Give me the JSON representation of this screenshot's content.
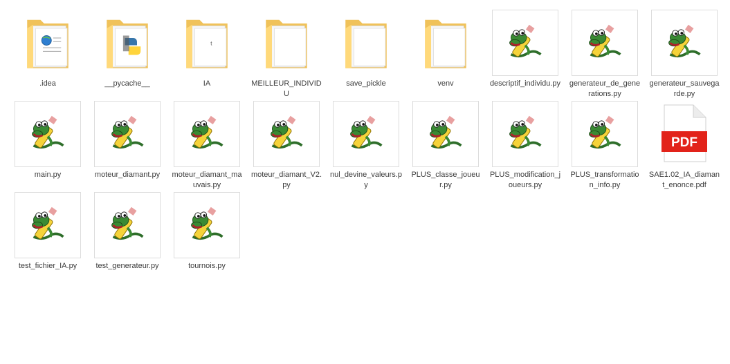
{
  "items": [
    {
      "name": ".idea",
      "kind": "folder",
      "preview": "web-doc"
    },
    {
      "name": "__pycache__",
      "kind": "folder",
      "preview": "python-doc"
    },
    {
      "name": "IA",
      "kind": "folder",
      "preview": "text-doc"
    },
    {
      "name": "MEILLEUR_INDIVIDU",
      "kind": "folder",
      "preview": "blank-doc"
    },
    {
      "name": "save_pickle",
      "kind": "folder",
      "preview": "blank-doc"
    },
    {
      "name": "venv",
      "kind": "folder",
      "preview": "blank-doc"
    },
    {
      "name": "descriptif_individu.py",
      "kind": "python"
    },
    {
      "name": "generateur_de_generations.py",
      "kind": "python"
    },
    {
      "name": "generateur_sauvegarde.py",
      "kind": "python"
    },
    {
      "name": "main.py",
      "kind": "python"
    },
    {
      "name": "moteur_diamant.py",
      "kind": "python"
    },
    {
      "name": "moteur_diamant_mauvais.py",
      "kind": "python"
    },
    {
      "name": "moteur_diamant_V2.py",
      "kind": "python"
    },
    {
      "name": "nul_devine_valeurs.py",
      "kind": "python"
    },
    {
      "name": "PLUS_classe_joueur.py",
      "kind": "python"
    },
    {
      "name": "PLUS_modification_joueurs.py",
      "kind": "python"
    },
    {
      "name": "PLUS_transformation_info.py",
      "kind": "python"
    },
    {
      "name": "SAE1.02_IA_diamant_enonce.pdf",
      "kind": "pdf",
      "badge": "PDF"
    },
    {
      "name": "test_fichier_IA.py",
      "kind": "python"
    },
    {
      "name": "test_generateur.py",
      "kind": "python"
    },
    {
      "name": "tournois.py",
      "kind": "python"
    }
  ],
  "colors": {
    "folder_back": "#f0c25a",
    "folder_front": "#ffd97a",
    "pdf_red": "#e2231a",
    "selection": "#e5f3ff",
    "label": "#3c3c3c"
  }
}
